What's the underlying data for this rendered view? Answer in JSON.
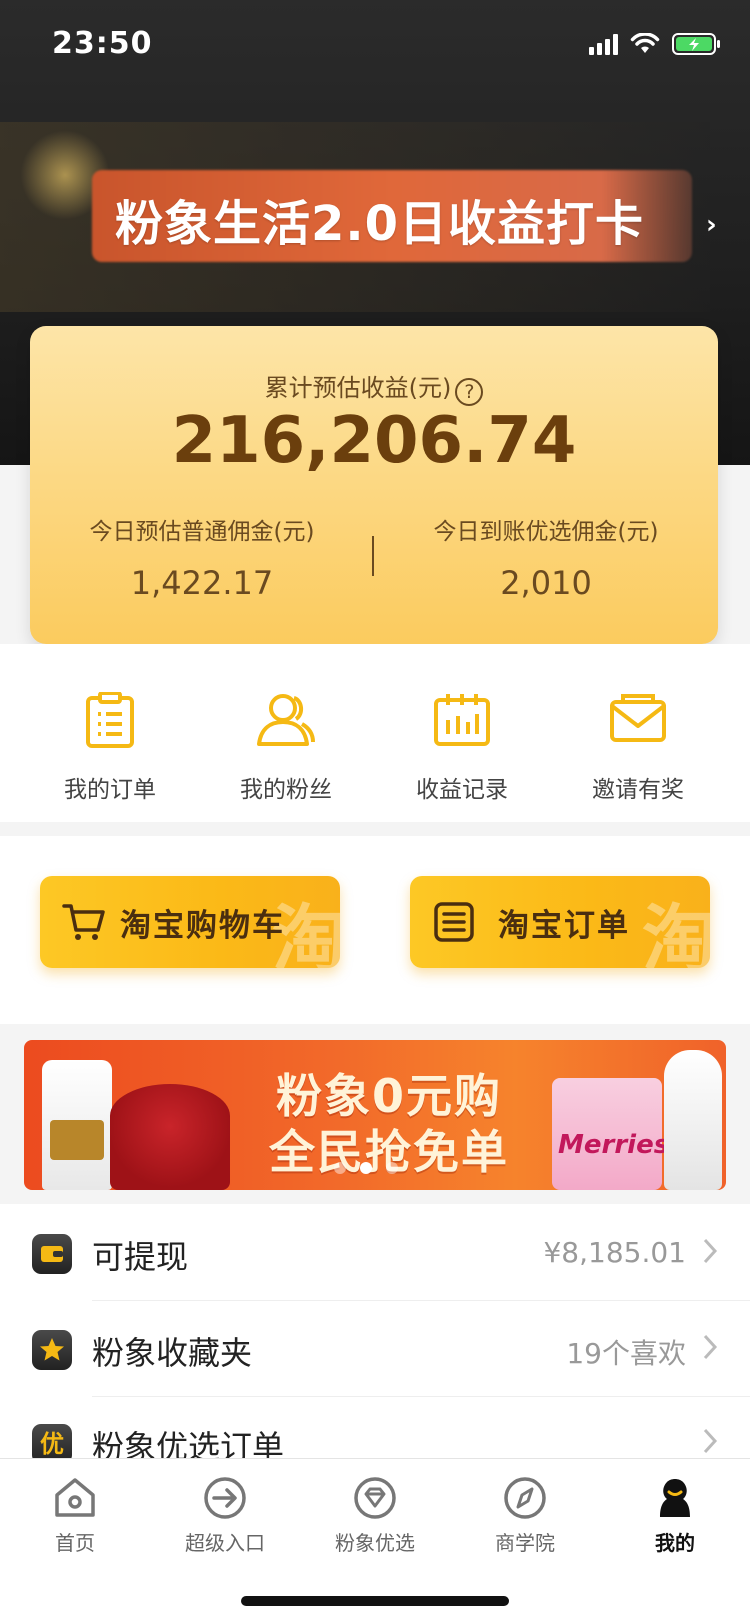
{
  "status_bar": {
    "time": "23:50"
  },
  "banner": {
    "title": "粉象生活2.0日收益打卡",
    "arrow": "›"
  },
  "earnings": {
    "total_label": "累计预估收益(元)",
    "help_glyph": "?",
    "total_value": "216,206.74",
    "today_common_label": "今日预估普通佣金(元)",
    "today_common_value": "1,422.17",
    "today_selected_label": "今日到账优选佣金(元)",
    "today_selected_value": "2,010"
  },
  "quick_actions": [
    {
      "label": "我的订单",
      "icon": "clipboard-icon"
    },
    {
      "label": "我的粉丝",
      "icon": "fans-icon"
    },
    {
      "label": "收益记录",
      "icon": "calendar-chart-icon"
    },
    {
      "label": "邀请有奖",
      "icon": "envelope-icon"
    }
  ],
  "taobao": {
    "cart_label": "淘宝购物车",
    "orders_label": "淘宝订单",
    "watermark": "淘"
  },
  "promo": {
    "line1": "粉象0元购",
    "line2": "全民抢免单",
    "diaper_brand": "Merries",
    "active_dot": 1
  },
  "list": [
    {
      "title": "可提现",
      "right": "¥8,185.01",
      "icon": "wallet-icon"
    },
    {
      "title": "粉象收藏夹",
      "right": "19个喜欢",
      "icon": "star-icon"
    },
    {
      "title": "粉象优选订单",
      "right": "",
      "icon": "you-badge-icon",
      "icon_text": "优"
    }
  ],
  "tabs": [
    {
      "label": "首页",
      "icon": "home-icon"
    },
    {
      "label": "超级入口",
      "icon": "enter-arrow-icon"
    },
    {
      "label": "粉象优选",
      "icon": "diamond-icon"
    },
    {
      "label": "商学院",
      "icon": "compass-icon"
    },
    {
      "label": "我的",
      "icon": "profile-icon",
      "active": true
    }
  ],
  "colors": {
    "card_gold": "#fcd986",
    "button_yellow": "#fdc825",
    "promo_orange": "#f26a2a",
    "dark_header": "#1f1f1f"
  }
}
